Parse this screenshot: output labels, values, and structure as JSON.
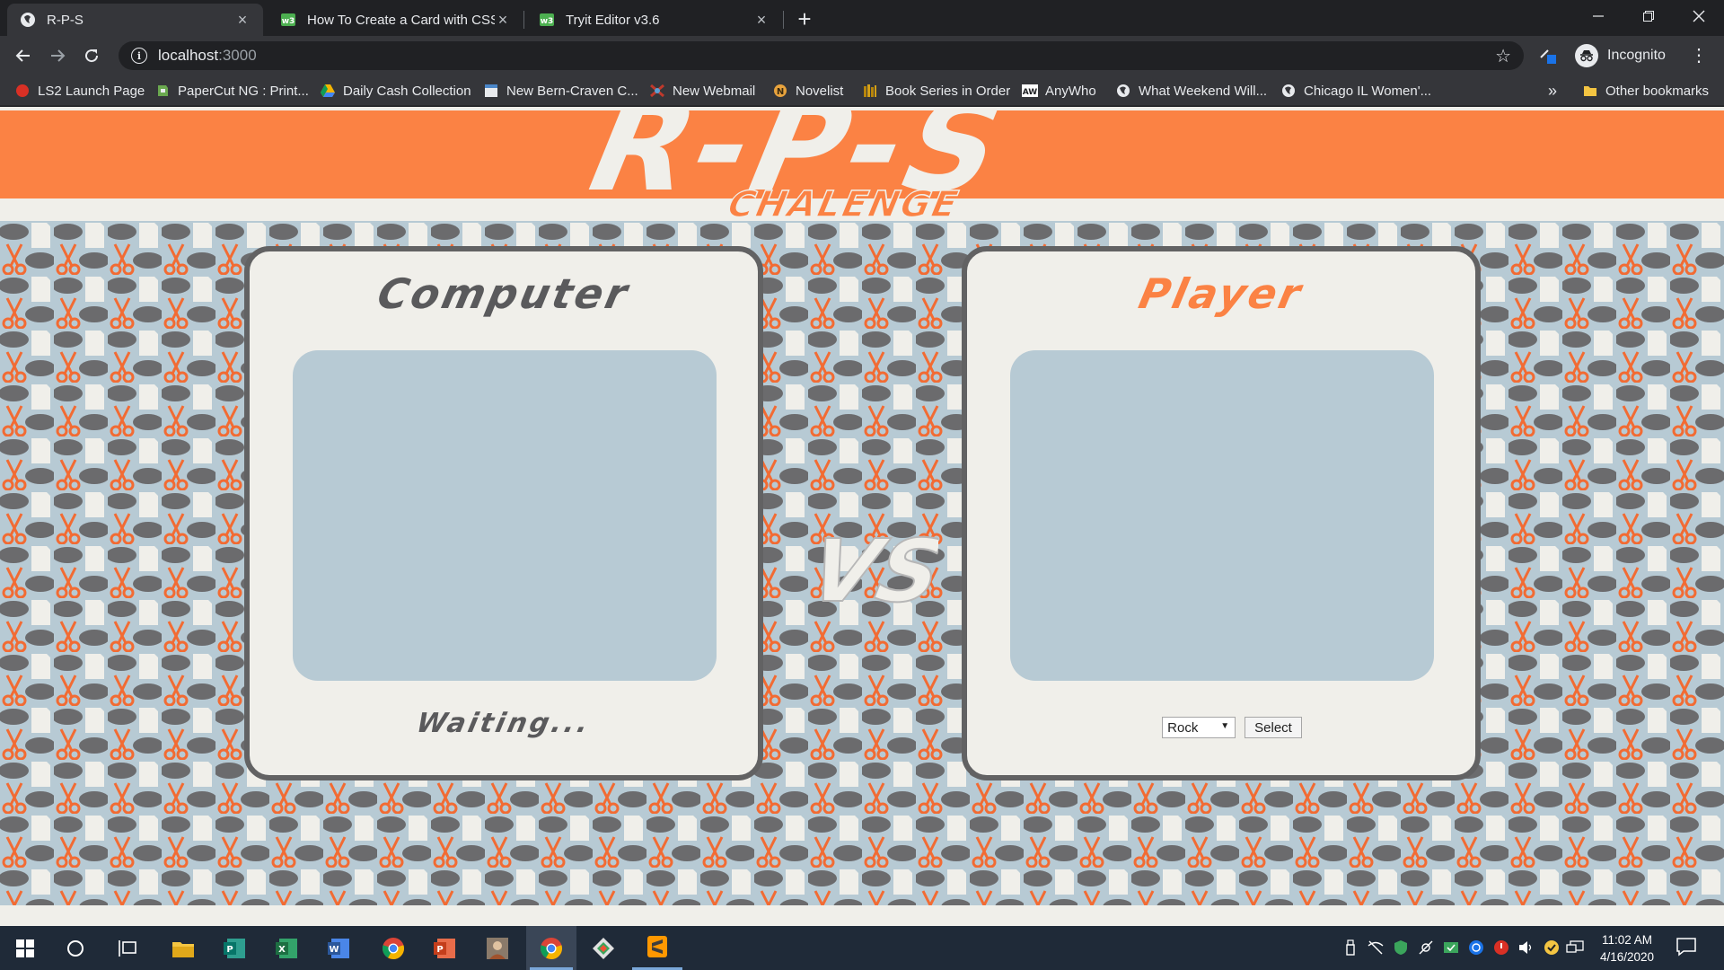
{
  "browser": {
    "tabs": [
      {
        "title": "R-P-S",
        "active": true
      },
      {
        "title": "How To Create a Card with CSS",
        "active": false
      },
      {
        "title": "Tryit Editor v3.6",
        "active": false
      }
    ],
    "address": {
      "host": "localhost",
      "port": ":3000"
    },
    "profile_label": "Incognito",
    "bookmarks": [
      {
        "label": "LS2 Launch Page",
        "icon": "red-circle-icon",
        "color": "#d93025"
      },
      {
        "label": "PaperCut NG : Print...",
        "icon": "papercut-icon",
        "color": "#6aa84f"
      },
      {
        "label": "Daily Cash Collection",
        "icon": "google-drive-icon",
        "color": "#f4b400"
      },
      {
        "label": "New Bern-Craven C...",
        "icon": "page-icon",
        "color": "#4a86c8"
      },
      {
        "label": "New Webmail",
        "icon": "webmail-icon",
        "color": "#c0392b"
      },
      {
        "label": "Novelist",
        "icon": "novelist-icon",
        "color": "#e8a33d"
      },
      {
        "label": "Book Series in Order",
        "icon": "books-icon",
        "color": "#b8860b"
      },
      {
        "label": "AnyWho",
        "icon": "anywho-icon",
        "color": "#ffffff"
      },
      {
        "label": "What Weekend Will...",
        "icon": "globe-icon",
        "color": "#e8eaed"
      },
      {
        "label": "Chicago IL Women'...",
        "icon": "globe-icon",
        "color": "#e8eaed"
      }
    ],
    "overflow_label": "»",
    "other_bookmarks": "Other bookmarks"
  },
  "app": {
    "logo_text": "R-P-S",
    "logo_subtext": "CHALENGE",
    "computer_title": "Computer",
    "computer_status": "Waiting...",
    "vs_text": "VS",
    "player_title": "Player",
    "selected_move": "Rock",
    "select_button": "Select",
    "colors": {
      "accent": "#fb8244",
      "panel_border": "#626263",
      "slot": "#b7cad4",
      "background": "#f0efea"
    }
  },
  "taskbar": {
    "time": "11:02 AM",
    "date": "4/16/2020"
  }
}
